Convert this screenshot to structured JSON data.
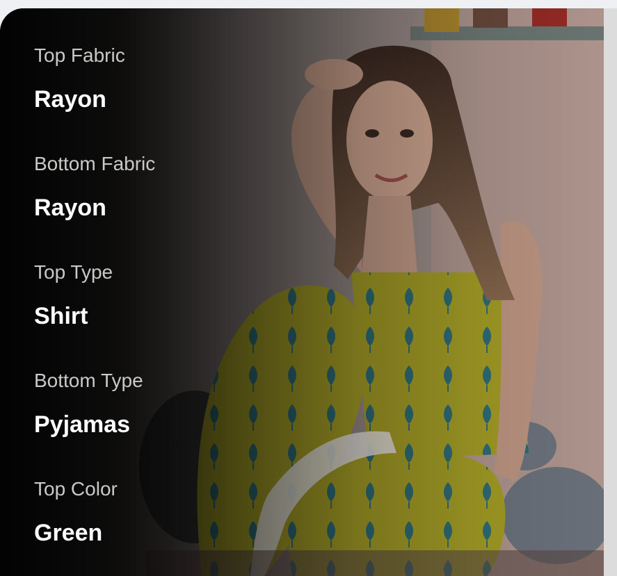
{
  "specs": [
    {
      "label": "Top Fabric",
      "value": "Rayon"
    },
    {
      "label": "Bottom Fabric",
      "value": "Rayon"
    },
    {
      "label": "Top Type",
      "value": "Shirt"
    },
    {
      "label": "Bottom Type",
      "value": "Pyjamas"
    },
    {
      "label": "Top Color",
      "value": "Green"
    }
  ],
  "colors": {
    "label": "#c9c9c9",
    "value": "#ffffff",
    "outfit": "#b9b22a",
    "print": "#2f6f7a"
  }
}
